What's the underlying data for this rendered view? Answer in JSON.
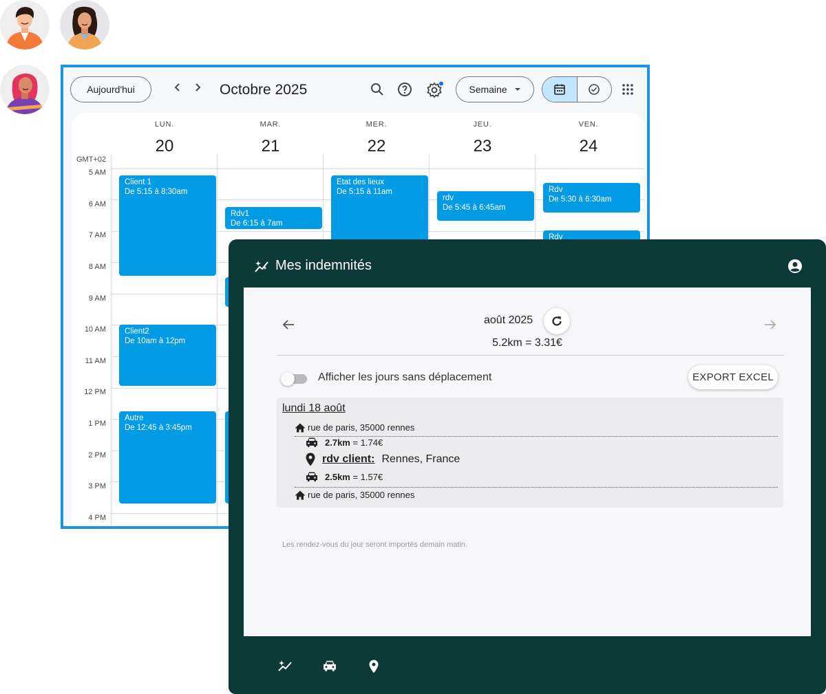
{
  "calendar": {
    "today_label": "Aujourd'hui",
    "prev_label": "‹",
    "next_label": "›",
    "month": "Octobre 2025",
    "view_label": "Semaine",
    "timezone": "GMT+02",
    "days": [
      {
        "name": "LUN.",
        "num": "20"
      },
      {
        "name": "MAR.",
        "num": "21"
      },
      {
        "name": "MER.",
        "num": "22"
      },
      {
        "name": "JEU.",
        "num": "23"
      },
      {
        "name": "VEN.",
        "num": "24"
      }
    ],
    "hours": [
      "5 AM",
      "6 AM",
      "7 AM",
      "8 AM",
      "9 AM",
      "10 AM",
      "11 AM",
      "12 PM",
      "1 PM",
      "2 PM",
      "3 PM",
      "4 PM"
    ],
    "events": [
      {
        "title": "Client 1",
        "time": "De 5:15 à 8:30am"
      },
      {
        "title": "Rdv1",
        "time": "De 6:15 à 7am"
      },
      {
        "title": "Etat des lieux",
        "time": "De 5:15 à 11am"
      },
      {
        "title": "rdv",
        "time": "De 5:45 à 6:45am"
      },
      {
        "title": "Rdv",
        "time": "De 5:30 à 6:30am"
      },
      {
        "title": "Rdv",
        "time": ""
      },
      {
        "title": "Client2",
        "time": "De 10am à 12pm"
      },
      {
        "title": "Autre",
        "time": "De 12:45 à 3:45pm"
      }
    ],
    "event_color": "#039be5",
    "border_color": "#1a95e4"
  },
  "app": {
    "title": "Mes indemnités",
    "month": "août 2025",
    "total": "5.2km = 3.31€",
    "toggle_label": "Afficher les jours sans déplacement",
    "toggle_on": false,
    "export_label": "EXPORT EXCEL",
    "day": {
      "title": "lundi 18 août",
      "start_address": "rue de paris, 35000 rennes",
      "trip1_km": "2.7km",
      "trip1_cost": "= 1.74€",
      "stop_label": "rdv client:",
      "stop_place": "Rennes, France",
      "trip2_km": "2.5km",
      "trip2_cost": "= 1.57€",
      "end_address": "rue de paris, 35000 rennes"
    },
    "note": "Les rendez-vous du jour seront importés demain matin.",
    "header_color": "#0d3838",
    "nav_icons": [
      "sparkle-icon",
      "car-icon",
      "location-pin-icon"
    ]
  }
}
